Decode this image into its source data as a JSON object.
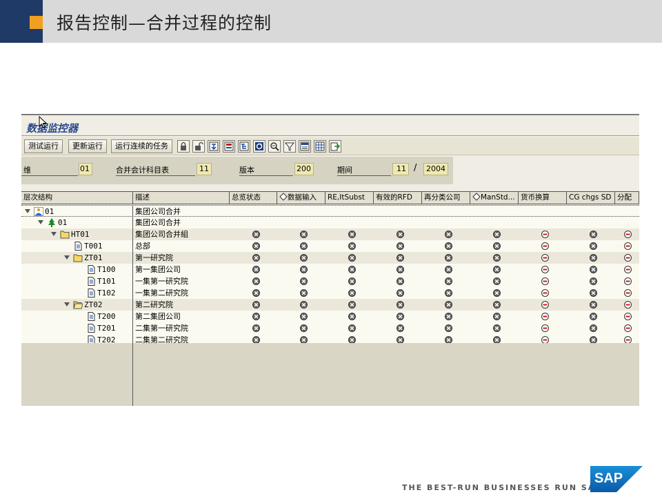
{
  "slide": {
    "title": "报告控制—合并过程的控制",
    "footer": "THE BEST-RUN BUSINESSES RUN SAP",
    "logo_text": "SAP",
    "colors": {
      "header_bg": "#d9d9d9",
      "navy": "#1f3a66",
      "orange": "#f0a020"
    }
  },
  "window": {
    "title": "数据监控器"
  },
  "toolbar": {
    "buttons": [
      "测试运行",
      "更新运行",
      "运行连续的任务"
    ],
    "icons": [
      "lock-icon",
      "unlock-icon",
      "expand-icon",
      "collapse-icon",
      "tree-icon",
      "refresh-icon",
      "zoom-icon",
      "filter-icon",
      "layout-icon",
      "grid-icon",
      "export-icon"
    ]
  },
  "fields": [
    {
      "label": "维",
      "value": "01"
    },
    {
      "label": "合并会计科目表",
      "value": "11"
    },
    {
      "label": "版本",
      "value": "200"
    },
    {
      "label": "期间",
      "value": "11",
      "separator": "/",
      "year": "2004"
    }
  ],
  "table": {
    "tree_header": "层次结构",
    "desc_header": "描述",
    "columns": [
      "总览状态",
      "数据输入",
      "RE,ItSubst",
      "有效的RFD",
      "再分类公司",
      "ManStd...",
      "货币换算",
      "CG chgs SD",
      "分配"
    ],
    "column_flags": [
      false,
      true,
      false,
      false,
      false,
      true,
      false,
      false,
      false
    ],
    "rows": [
      {
        "node": "01",
        "desc": "集团公司合并",
        "level": 0,
        "icon": "hierarchy-icon",
        "expand": true,
        "statuses": []
      },
      {
        "node": "01",
        "desc": "集团公司合并",
        "level": 1,
        "icon": "tree-node-icon",
        "expand": true,
        "statuses": []
      },
      {
        "node": "HT01",
        "desc": "集团公司合并組",
        "level": 2,
        "icon": "folder-icon",
        "expand": true,
        "statuses": [
          "x",
          "x",
          "x",
          "x",
          "x",
          "x",
          "m",
          "x",
          "m"
        ]
      },
      {
        "node": "T001",
        "desc": "总部",
        "level": 3,
        "icon": "document-icon",
        "expand": false,
        "statuses": [
          "x",
          "x",
          "x",
          "x",
          "x",
          "x",
          "m",
          "x",
          "m"
        ]
      },
      {
        "node": "ZT01",
        "desc": "第一研究院",
        "level": 3,
        "icon": "folder-icon",
        "expand": true,
        "statuses": [
          "x",
          "x",
          "x",
          "x",
          "x",
          "x",
          "m",
          "x",
          "m"
        ]
      },
      {
        "node": "T100",
        "desc": "第一集团公司",
        "level": 4,
        "icon": "document-icon",
        "expand": false,
        "statuses": [
          "x",
          "x",
          "x",
          "x",
          "x",
          "x",
          "m",
          "x",
          "m"
        ]
      },
      {
        "node": "T101",
        "desc": "一集第一研究院",
        "level": 4,
        "icon": "document-icon",
        "expand": false,
        "statuses": [
          "x",
          "x",
          "x",
          "x",
          "x",
          "x",
          "m",
          "x",
          "m"
        ]
      },
      {
        "node": "T102",
        "desc": "一集第二研究院",
        "level": 4,
        "icon": "document-icon",
        "expand": false,
        "statuses": [
          "x",
          "x",
          "x",
          "x",
          "x",
          "x",
          "m",
          "x",
          "m"
        ]
      },
      {
        "node": "ZT02",
        "desc": "第二研究院",
        "level": 3,
        "icon": "folder-open-icon",
        "expand": true,
        "statuses": [
          "x",
          "x",
          "x",
          "x",
          "x",
          "x",
          "m",
          "x",
          "m"
        ]
      },
      {
        "node": "T200",
        "desc": "第二集团公司",
        "level": 4,
        "icon": "document-icon",
        "expand": false,
        "statuses": [
          "x",
          "x",
          "x",
          "x",
          "x",
          "x",
          "m",
          "x",
          "m"
        ]
      },
      {
        "node": "T201",
        "desc": "二集第一研究院",
        "level": 4,
        "icon": "document-icon",
        "expand": false,
        "statuses": [
          "x",
          "x",
          "x",
          "x",
          "x",
          "x",
          "m",
          "x",
          "m"
        ]
      },
      {
        "node": "T202",
        "desc": "二集第二研究院",
        "level": 4,
        "icon": "document-icon",
        "expand": false,
        "statuses": [
          "x",
          "x",
          "x",
          "x",
          "x",
          "x",
          "m",
          "x",
          "m"
        ]
      }
    ]
  }
}
